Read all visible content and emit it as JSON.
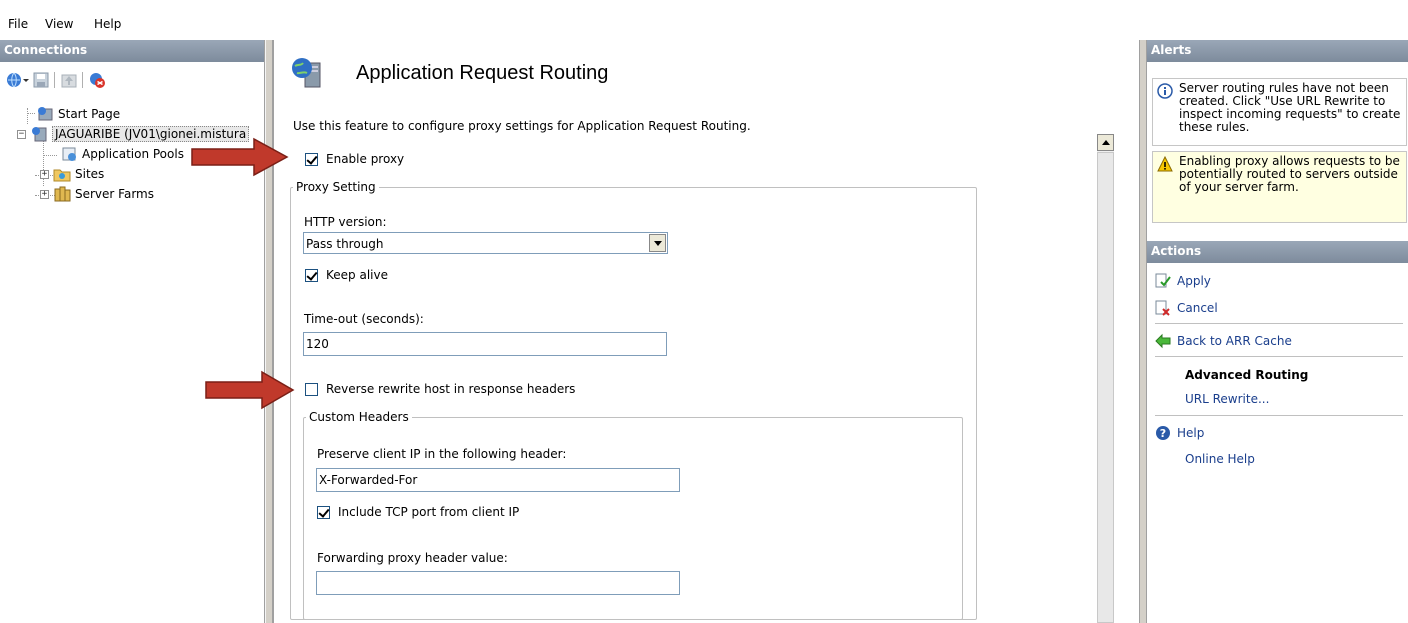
{
  "menu": {
    "file": "File",
    "view": "View",
    "help": "Help"
  },
  "connections": {
    "header": "Connections",
    "tree": {
      "start_page": "Start Page",
      "server": "JAGUARIBE (JV01\\gionei.mistura",
      "app_pools": "Application Pools",
      "sites": "Sites",
      "server_farms": "Server Farms"
    }
  },
  "main": {
    "title": "Application Request Routing",
    "description": "Use this feature to configure proxy settings for Application Request Routing.",
    "enable_proxy": {
      "label": "Enable proxy",
      "checked": true
    },
    "proxy_setting": {
      "legend": "Proxy Setting",
      "http_version_label": "HTTP version:",
      "http_version_value": "Pass through",
      "keep_alive": {
        "label": "Keep alive",
        "checked": true
      },
      "timeout_label": "Time-out (seconds):",
      "timeout_value": "120",
      "reverse_rewrite": {
        "label": "Reverse rewrite host in response headers",
        "checked": false
      },
      "custom_headers": {
        "legend": "Custom Headers",
        "preserve_ip_label": "Preserve client IP in the following header:",
        "preserve_ip_value": "X-Forwarded-For",
        "include_tcp_port": {
          "label": "Include TCP port from client IP",
          "checked": true
        },
        "forwarding_label": "Forwarding proxy header value:",
        "forwarding_value": ""
      }
    }
  },
  "alerts": {
    "header": "Alerts",
    "info_text": "Server routing rules have not been created. Click \"Use URL Rewrite to inspect incoming requests\" to create these rules.",
    "warning_text": "Enabling proxy allows requests to be potentially routed to servers outside of your server farm."
  },
  "actions": {
    "header": "Actions",
    "apply": "Apply",
    "cancel": "Cancel",
    "back": "Back to ARR Cache",
    "advanced_routing": "Advanced Routing",
    "url_rewrite": "URL Rewrite...",
    "help": "Help",
    "online_help": "Online Help"
  },
  "colors": {
    "arrow": "#c0392b",
    "pane_header": "#8896a8",
    "link": "#1a3e8c",
    "warning_bg": "#ffffe1"
  }
}
